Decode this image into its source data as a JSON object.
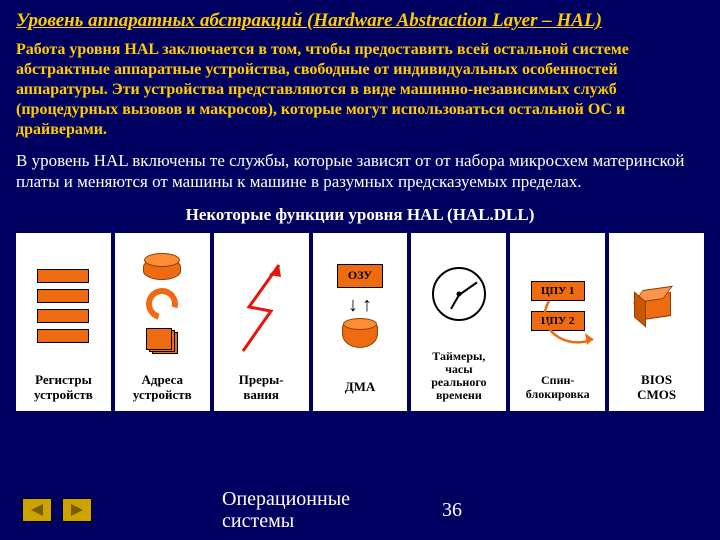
{
  "title": "Уровень аппаратных абстракций (Hardware Abstraction Layer – HAL)",
  "para1": "Работа уровня HAL заключается в том, чтобы предоставить всей остальной системе абстрактные аппаратные устройства, свободные от индивидуальных особенностей аппаратуры. Эти устройства представляются в виде машинно-независимых служб (процедурных вызовов и макросов), которые могут использоваться остальной ОС и драйверами.",
  "para2": " В уровень HAL включены те службы, которые зависят от от набора микросхем материнской платы и меняются от машины к машине в разумных предсказуемых пределах.",
  "subtitle": "Некоторые функции уровня  HAL (HAL.DLL)",
  "cells": {
    "c1": "Регистры\nустройств",
    "c2": "Адреса\nустройств",
    "c3": "Преры-\nвания",
    "c4_ozu": "ОЗУ",
    "c4": "ДМА",
    "c5": "Таймеры,\nчасы\nреального\nвремени",
    "c6_cpu1": "ЦПУ 1",
    "c6_cpu2": "ЦПУ 2",
    "c6": "Спин-\nблокировка",
    "c7": "BIOS\nCMOS"
  },
  "footer": {
    "label": "Операционные\nсистемы",
    "page": "36"
  }
}
